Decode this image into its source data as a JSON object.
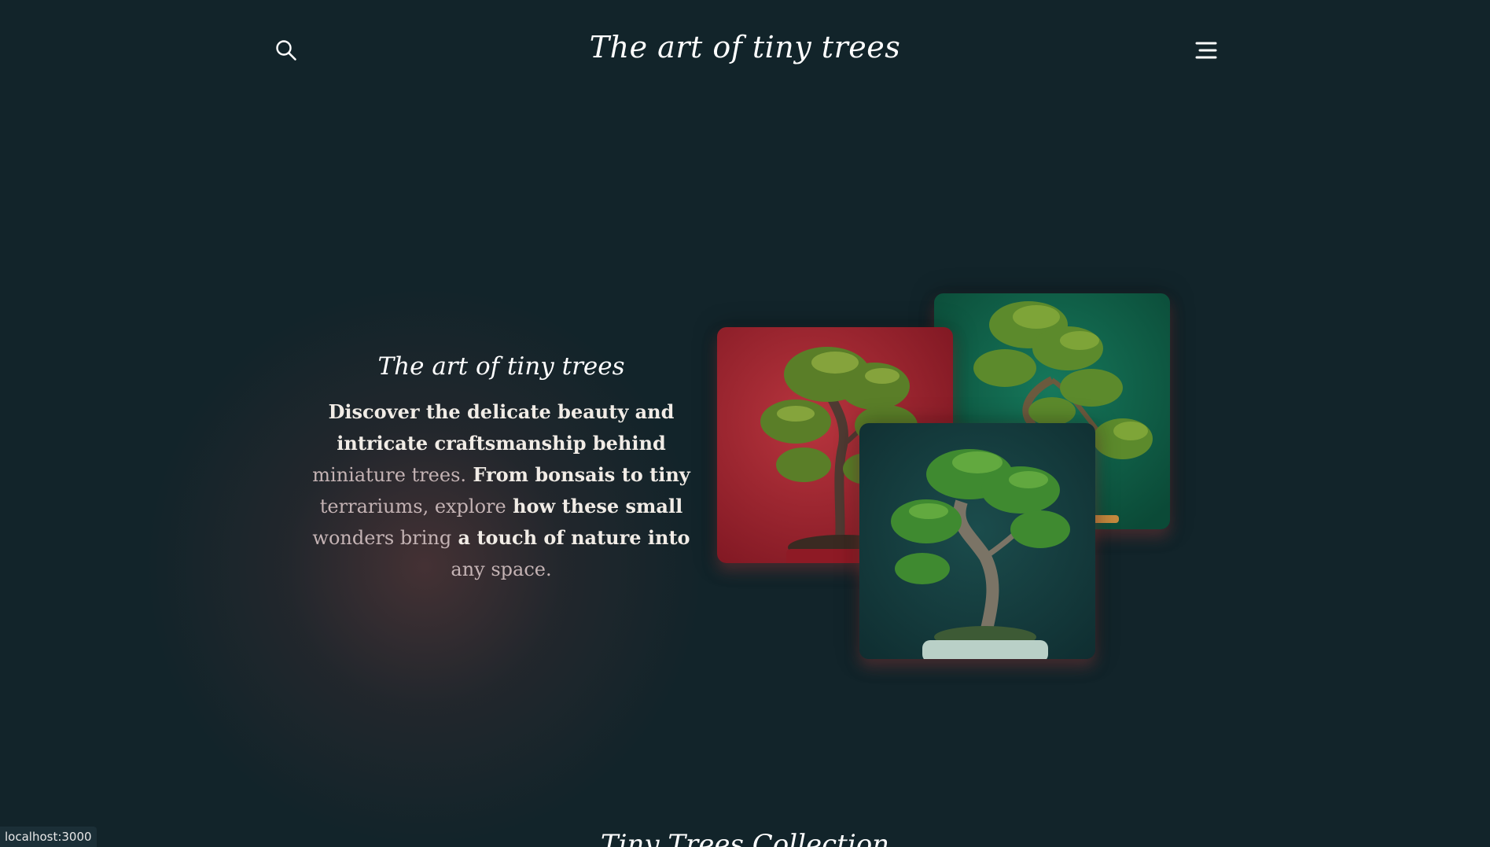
{
  "header": {
    "title": "The art of tiny trees",
    "search_icon": "search-icon",
    "menu_icon": "hamburger-menu-icon"
  },
  "hero": {
    "heading": "The art of tiny trees",
    "desc_segments": [
      {
        "text": "Discover the delicate beauty and intricate craftsmanship behind ",
        "style": "bright"
      },
      {
        "text": "miniature trees.",
        "style": "fade"
      },
      {
        "text": " From bonsais to tiny ",
        "style": "bright"
      },
      {
        "text": "terrariums, explore",
        "style": "fade"
      },
      {
        "text": " how these small ",
        "style": "bright"
      },
      {
        "text": "wonders bring",
        "style": "fade"
      },
      {
        "text": " a touch of nature into ",
        "style": "bright"
      },
      {
        "text": "any space.",
        "style": "fade"
      }
    ]
  },
  "images": [
    {
      "name": "bonsai-red-background-image",
      "background": "#a52632"
    },
    {
      "name": "bonsai-green-background-image",
      "background": "#0f5a45"
    },
    {
      "name": "bonsai-teal-background-image",
      "background": "#153c3e"
    }
  ],
  "collection": {
    "title": "Tiny Trees Collection"
  },
  "status_bar": {
    "url": "localhost:3000"
  },
  "colors": {
    "background": "#12242a",
    "text": "#ffffff",
    "muted_text": "#c4b3b4"
  }
}
